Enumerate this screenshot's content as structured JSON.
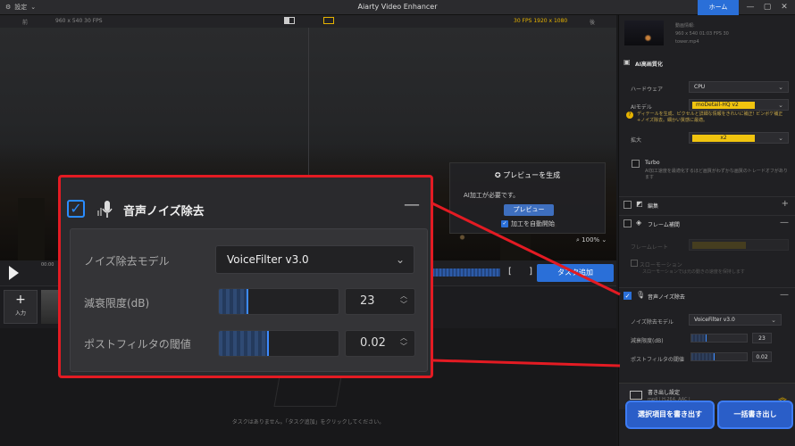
{
  "titlebar": {
    "settings_label": "設定",
    "title": "Aiarty Video Enhancer",
    "home_label": "ホーム"
  },
  "preview": {
    "before_label": "前",
    "after_label": "後",
    "before_info": "960 x 540  30 FPS",
    "after_info": "30 FPS  1920 x 1080",
    "generate_title": "プレビューを生成",
    "need_processing": "AI加工が必要です。",
    "preview_button": "プレビュー",
    "auto_start": "加工を自動開始",
    "zoom": "100%"
  },
  "controls": {
    "add_task": "タスク追加",
    "time": "00:00"
  },
  "filmstrip": {
    "add_input_label": "入力"
  },
  "tasks": {
    "empty_text": "タスクはありません。「タスク追加」をクリックしてください。"
  },
  "right": {
    "video_info_label": "動画情報:",
    "video_meta1": "960 x 540   01:03   FPS 30",
    "video_file": "tower.mp4",
    "ai_section": "AI高画質化",
    "hardware_label": "ハードウェア",
    "hardware_value": "CPU",
    "model_label": "AIモデル",
    "model_value": "moDetail-HQ  v2",
    "model_hint": "ディテールを生成、ピクセルと詳細な情報をきれいに補正! ビンボケ補正+ノイズ除去。細かい質感に最適。",
    "scale_label": "拡大",
    "scale_value": "x2",
    "turbo_label": "Turbo",
    "turbo_desc": "AI加工速度を最適化するほど画質がわずかな画質のトレードオフがあります",
    "edit_section": "編集",
    "frame_section": "フレーム補間",
    "framerate_label": "フレームレート",
    "slowmo_label": "スローモーション",
    "slowmo_desc": "スローモーションでは元の動きの速度を保持します",
    "noise_section": "音声ノイズ除去",
    "noise_model_label": "ノイズ除去モデル",
    "noise_model_value": "VoiceFilter v3.0",
    "attenuation_label": "減衰限度(dB)",
    "attenuation_value": "23",
    "postfilter_label": "ポストフィルタの閾値",
    "postfilter_value": "0.02",
    "export_title": "書き出し設定",
    "export_format": "mp4 | H.264, AAC |",
    "export_selected": "選択項目を書き出す",
    "export_all": "一括書き出し"
  },
  "callout": {
    "title": "音声ノイズ除去",
    "model_label": "ノイズ除去モデル",
    "model_value": "VoiceFilter v3.0",
    "attenuation_label": "減衰限度(dB)",
    "attenuation_value": "23",
    "attenuation_level": 0.23,
    "postfilter_label": "ポストフィルタの閾値",
    "postfilter_value": "0.02",
    "postfilter_level": 0.4
  },
  "colors": {
    "accent": "#2a6fd8",
    "highlight": "#e31b23",
    "warning": "#f1c40f"
  }
}
